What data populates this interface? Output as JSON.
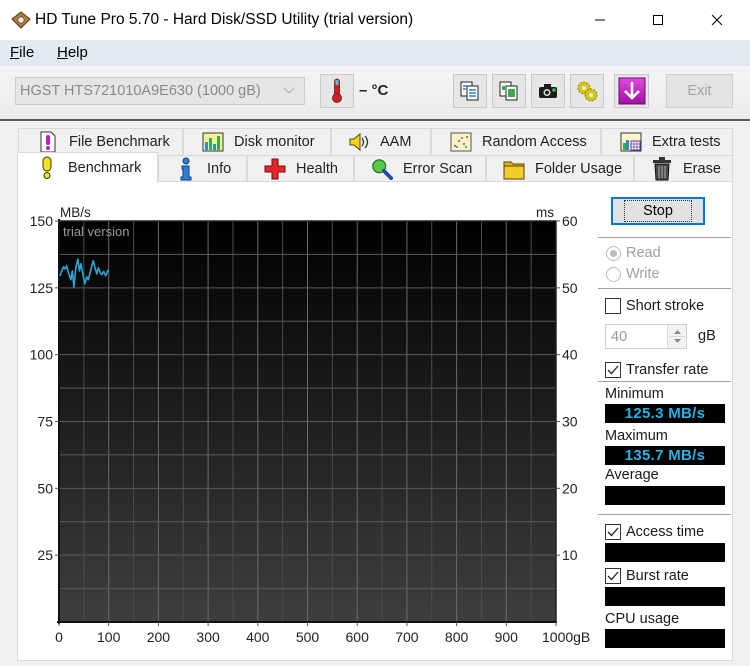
{
  "window": {
    "title": "HD Tune Pro 5.70 - Hard Disk/SSD Utility (trial version)",
    "controls": [
      "minimize-icon",
      "maximize-icon",
      "close-icon"
    ]
  },
  "menu": [
    {
      "label": "File"
    },
    {
      "label": "Help"
    }
  ],
  "toolbar": {
    "drive": "HGST HTS721010A9E630 (1000 gB)",
    "temperature": "– °C",
    "buttons": [
      {
        "icon": "thermometer-icon"
      },
      {
        "icon": "copy-text-icon"
      },
      {
        "icon": "copy-image-icon"
      },
      {
        "icon": "screenshot-camera-icon"
      },
      {
        "icon": "options-gears-icon"
      },
      {
        "icon": "save-down-arrow-icon",
        "color": "#c01fc0"
      }
    ],
    "exit_label": "Exit"
  },
  "tabs": {
    "row1": [
      {
        "label": "File Benchmark",
        "icon": "file-benchmark-icon"
      },
      {
        "label": "Disk monitor",
        "icon": "disk-monitor-icon"
      },
      {
        "label": "AAM",
        "icon": "speaker-icon"
      },
      {
        "label": "Random Access",
        "icon": "random-access-icon"
      },
      {
        "label": "Extra tests",
        "icon": "extra-tests-icon"
      }
    ],
    "row2": [
      {
        "label": "Benchmark",
        "icon": "benchmark-exclamation-icon",
        "active": true
      },
      {
        "label": "Info",
        "icon": "info-icon"
      },
      {
        "label": "Health",
        "icon": "health-cross-icon"
      },
      {
        "label": "Error Scan",
        "icon": "magnifier-icon"
      },
      {
        "label": "Folder Usage",
        "icon": "folder-icon"
      },
      {
        "label": "Erase",
        "icon": "trash-icon"
      }
    ]
  },
  "benchmark": {
    "stop_label": "Stop",
    "mode": {
      "read_label": "Read",
      "read_checked": true,
      "write_label": "Write",
      "write_checked": false,
      "disabled": true
    },
    "short_stroke": {
      "label": "Short stroke",
      "checked": false,
      "value": "40",
      "unit": "gB"
    },
    "transfer_rate": {
      "label": "Transfer rate",
      "checked": true
    },
    "minimum": {
      "label": "Minimum",
      "value": "125.3 MB/s"
    },
    "maximum": {
      "label": "Maximum",
      "value": "135.7 MB/s"
    },
    "average": {
      "label": "Average",
      "value": ""
    },
    "access_time": {
      "label": "Access time",
      "checked": true,
      "value": ""
    },
    "burst_rate": {
      "label": "Burst rate",
      "checked": true,
      "value": ""
    },
    "cpu_usage": {
      "label": "CPU usage",
      "value": ""
    },
    "readout_color": "#27b2e6"
  },
  "chart_data": {
    "type": "line",
    "title": "",
    "annotation": "trial version",
    "xlabel": "gB",
    "ylabel": "MB/s",
    "y2label": "ms",
    "xlim": [
      0,
      1000
    ],
    "ylim": [
      0,
      150
    ],
    "y2lim": [
      0,
      60
    ],
    "x_ticks": [
      0,
      100,
      200,
      300,
      400,
      500,
      600,
      700,
      800,
      900,
      1000
    ],
    "x_tick_labels": [
      "0",
      "100",
      "200",
      "300",
      "400",
      "500",
      "600",
      "700",
      "800",
      "900",
      "1000gB"
    ],
    "y_ticks": [
      25,
      50,
      75,
      100,
      125,
      150
    ],
    "y_tick_labels": [
      "25",
      "50",
      "75",
      "100",
      "125",
      "150"
    ],
    "y2_ticks": [
      10,
      20,
      30,
      40,
      50,
      60
    ],
    "y2_tick_labels": [
      "10",
      "20",
      "30",
      "40",
      "50",
      "60"
    ],
    "grid": true,
    "grid_x_step": 50,
    "grid_y_step": 12.5,
    "series": [
      {
        "name": "Transfer rate",
        "color": "#2aa7d8",
        "x": [
          2,
          5,
          9,
          12,
          15,
          19,
          24,
          27,
          30,
          34,
          38,
          41,
          44,
          48,
          52,
          56,
          59,
          62,
          66,
          69,
          73,
          76,
          79,
          83,
          86,
          90,
          94,
          99
        ],
        "y": [
          129.5,
          131.1,
          132.8,
          132.1,
          133.2,
          130.7,
          128.0,
          131.3,
          125.3,
          132.6,
          135.7,
          131.3,
          134.0,
          130.2,
          126.5,
          129.1,
          128.0,
          130.2,
          133.2,
          135.1,
          132.1,
          130.2,
          132.5,
          130.7,
          129.9,
          131.1,
          129.5,
          131.7
        ]
      }
    ]
  }
}
